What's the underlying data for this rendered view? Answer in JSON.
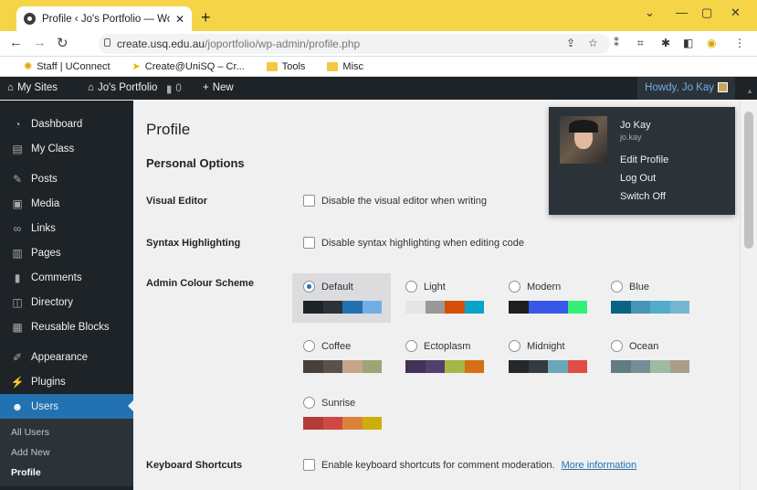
{
  "browser": {
    "tab_title": "Profile ‹ Jo's Portfolio — WordPre",
    "tab_close": "✕",
    "new_tab": "+",
    "url_host": "create.usq.edu.au",
    "url_path": "/joportfolio/wp-admin/profile.php",
    "bookmarks": [
      "Staff | UConnect",
      "Create@UniSQ – Cr...",
      "Tools",
      "Misc"
    ]
  },
  "adminbar": {
    "my_sites": "My Sites",
    "site_name": "Jo's Portfolio",
    "comments_count": "0",
    "new_label": "New",
    "howdy": "Howdy, Jo Kay"
  },
  "sidebar": {
    "items": [
      "Dashboard",
      "My Class",
      "Posts",
      "Media",
      "Links",
      "Pages",
      "Comments",
      "Directory",
      "Reusable Blocks",
      "Appearance",
      "Plugins",
      "Users"
    ],
    "submenu": [
      "All Users",
      "Add New",
      "Profile"
    ]
  },
  "main": {
    "title": "Profile",
    "section": "Personal Options",
    "visual_editor_label": "Visual Editor",
    "visual_editor_text": "Disable the visual editor when writing",
    "syntax_label": "Syntax Highlighting",
    "syntax_text": "Disable syntax highlighting when editing code",
    "colour_label": "Admin Colour Scheme",
    "keyboard_label": "Keyboard Shortcuts",
    "keyboard_text": "Enable keyboard shortcuts for comment moderation.",
    "keyboard_link": "More information"
  },
  "schemes": [
    {
      "name": "Default",
      "selected": true,
      "colors": [
        "#1d2327",
        "#2c3338",
        "#2271b1",
        "#72aee6"
      ]
    },
    {
      "name": "Light",
      "selected": false,
      "colors": [
        "#e5e5e5",
        "#999999",
        "#d64e07",
        "#04a4cc"
      ]
    },
    {
      "name": "Modern",
      "selected": false,
      "colors": [
        "#1e1e1e",
        "#3858e9",
        "#3858e9",
        "#33f078"
      ]
    },
    {
      "name": "Blue",
      "selected": false,
      "colors": [
        "#096484",
        "#4796b3",
        "#52accc",
        "#74b6ce"
      ]
    },
    {
      "name": "Coffee",
      "selected": false,
      "colors": [
        "#46403c",
        "#59524c",
        "#c7a589",
        "#9ea476"
      ]
    },
    {
      "name": "Ectoplasm",
      "selected": false,
      "colors": [
        "#413256",
        "#523f6d",
        "#a3b745",
        "#d46f15"
      ]
    },
    {
      "name": "Midnight",
      "selected": false,
      "colors": [
        "#25282b",
        "#363b3f",
        "#69a8bb",
        "#e14d43"
      ]
    },
    {
      "name": "Ocean",
      "selected": false,
      "colors": [
        "#627c83",
        "#738e96",
        "#9ebaa0",
        "#aa9d88"
      ]
    },
    {
      "name": "Sunrise",
      "selected": false,
      "colors": [
        "#b43c38",
        "#cf4944",
        "#dd823b",
        "#ccaf0b"
      ]
    }
  ],
  "account_menu": {
    "name": "Jo Kay",
    "username": "jo.kay",
    "links": [
      "Edit Profile",
      "Log Out",
      "Switch Off"
    ]
  }
}
